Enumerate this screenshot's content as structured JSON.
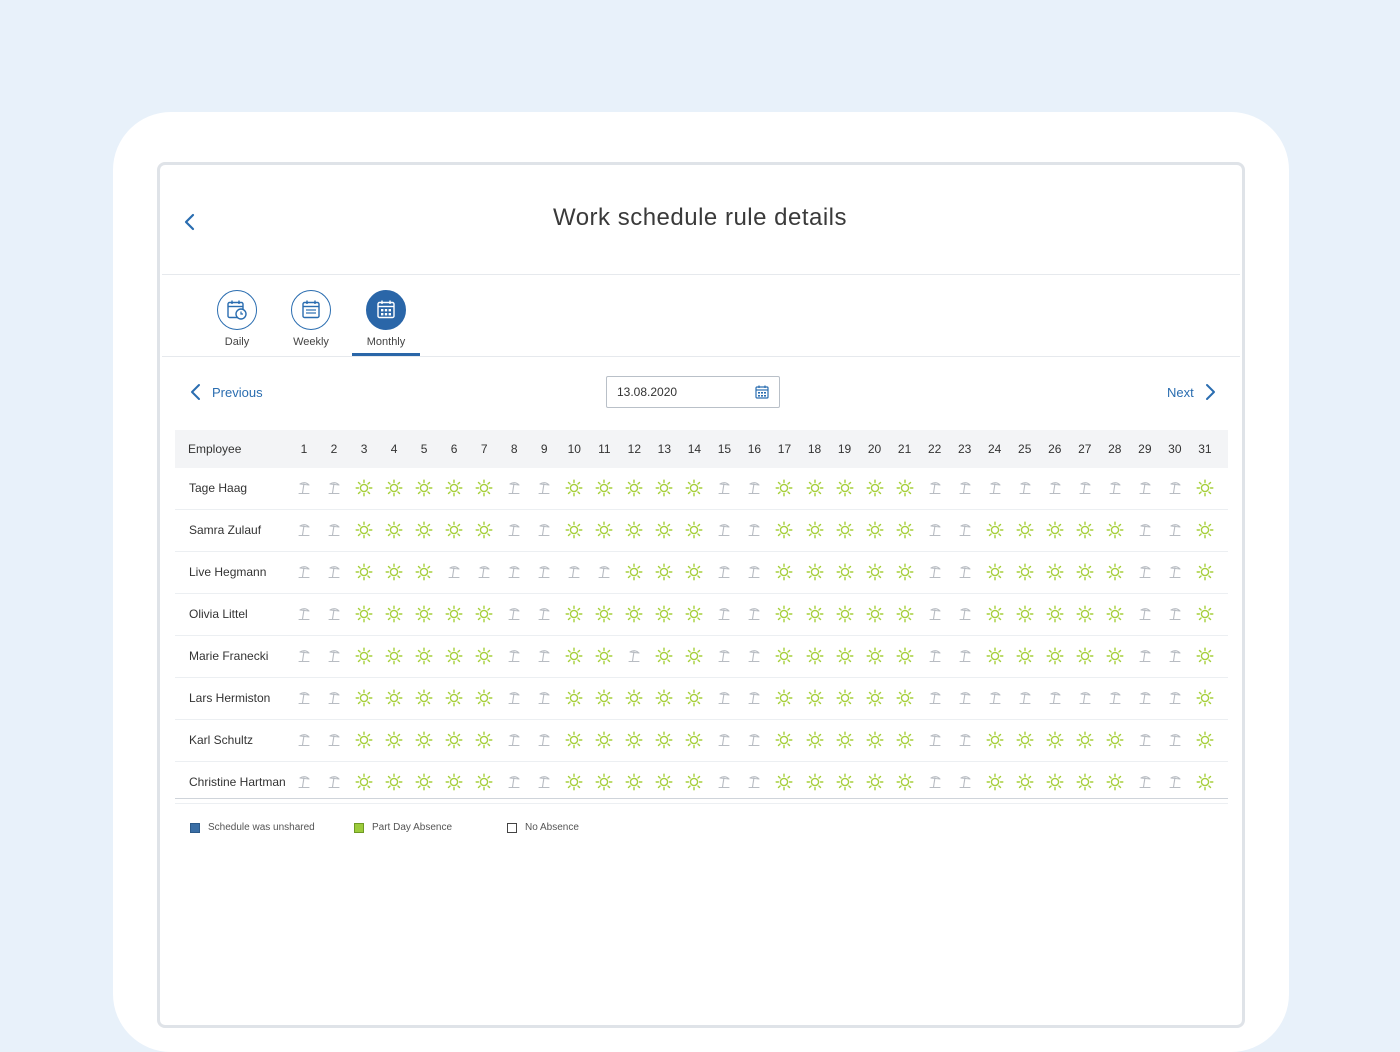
{
  "header": {
    "title": "Work schedule rule details"
  },
  "tabs": [
    {
      "id": "daily",
      "label": "Daily",
      "active": false
    },
    {
      "id": "weekly",
      "label": "Weekly",
      "active": false
    },
    {
      "id": "monthly",
      "label": "Monthly",
      "active": true
    }
  ],
  "navigation": {
    "previous_label": "Previous",
    "next_label": "Next",
    "date_value": "13.08.2020"
  },
  "table": {
    "employee_header": "Employee",
    "days": [
      1,
      2,
      3,
      4,
      5,
      6,
      7,
      8,
      9,
      10,
      11,
      12,
      13,
      14,
      15,
      16,
      17,
      18,
      19,
      20,
      21,
      22,
      23,
      24,
      25,
      26,
      27,
      28,
      29,
      30,
      31
    ],
    "rows": [
      {
        "name": "Tage Haag",
        "cells": "HHSSSSSHHSSSSSHHSSSSSHHHHHHHHHS"
      },
      {
        "name": "Samra Zulauf",
        "cells": "HHSSSSSHHSSSSSHHSSSSSHHSSSSSHHS"
      },
      {
        "name": "Live Hegmann",
        "cells": "HHSSSHHHHHHSSSHHSSSSSHHSSSSSHHS"
      },
      {
        "name": "Olivia Littel",
        "cells": "HHSSSSSHHSSSSSHHSSSSSHHSSSSSHHS"
      },
      {
        "name": "Marie Franecki",
        "cells": "HHSSSSSHHSSHSSHHSSSSSHHSSSSSHHS"
      },
      {
        "name": "Lars Hermiston",
        "cells": "HHSSSSSHHSSSSSHHSSSSSHHHHHHHHHS"
      },
      {
        "name": "Karl Schultz",
        "cells": "HHSSSSSHHSSSSSHHSSSSSHHSSSSSHHS"
      },
      {
        "name": "Christine Hartman",
        "cells": "HHSSSSSHHSSSSSHHSSSSSHHSSSSSHHS"
      }
    ],
    "icon_names": {
      "S": "sun-icon",
      "H": "beach-umbrella-icon"
    }
  },
  "legend": [
    {
      "label": "Schedule was unshared",
      "color": "#3a6ea5"
    },
    {
      "label": "Part Day Absence",
      "color": "#9ccb3b"
    },
    {
      "label": "No Absence",
      "color": "#ffffff"
    }
  ],
  "colors": {
    "accent": "#2a6db0",
    "sun": "#a6cf3a",
    "holiday": "#b8bcc2"
  }
}
